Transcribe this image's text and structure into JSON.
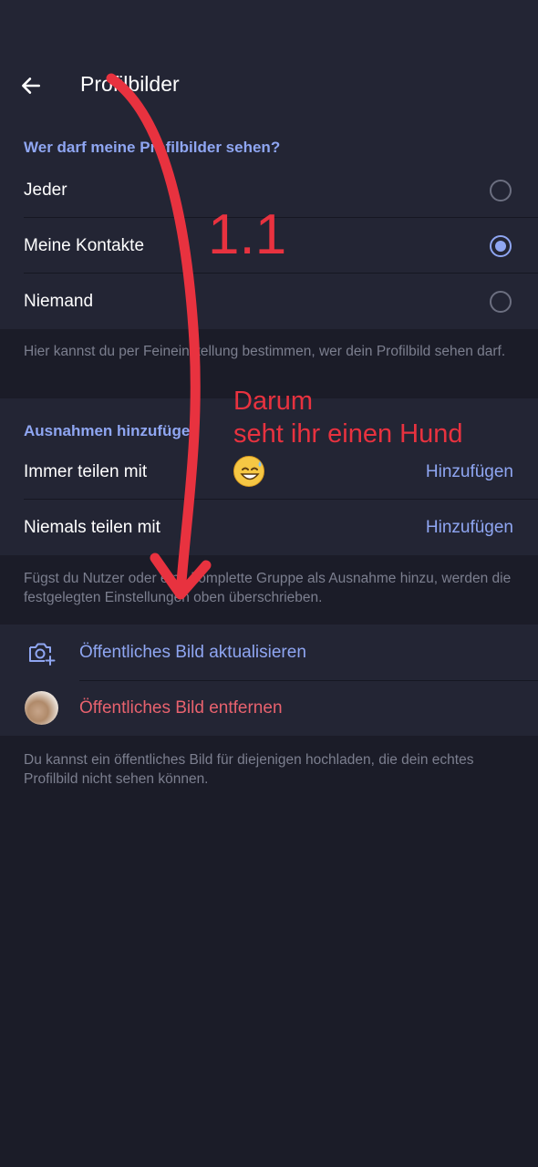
{
  "header": {
    "title": "Profilbilder",
    "back_icon": "arrow-left-icon"
  },
  "visibility": {
    "section_title": "Wer darf meine Profilbilder sehen?",
    "options": [
      {
        "label": "Jeder",
        "selected": false
      },
      {
        "label": "Meine Kontakte",
        "selected": true
      },
      {
        "label": "Niemand",
        "selected": false
      }
    ],
    "hint": "Hier kannst du per Feineinstellung bestimmen, wer dein Profilbild sehen darf."
  },
  "exceptions": {
    "section_title": "Ausnahmen hinzufügen",
    "rows": [
      {
        "label": "Immer teilen mit",
        "action": "Hinzufügen"
      },
      {
        "label": "Niemals teilen mit",
        "action": "Hinzufügen"
      }
    ],
    "hint": "Fügst du Nutzer oder eine komplette Gruppe als Ausnahme hinzu, werden die festgelegten Einstellungen oben überschrieben."
  },
  "public_photo": {
    "update_label": "Öffentliches Bild aktualisieren",
    "update_icon": "camera-add-icon",
    "remove_label": "Öffentliches Bild entfernen",
    "remove_icon": "avatar-thumbnail",
    "hint": "Du kannst ein öffentliches Bild für diejenigen hochladen, die dein echtes Profilbild nicht sehen können."
  },
  "annotation": {
    "number": "1.1",
    "line1": "Darum",
    "line2": "seht ihr einen Hund",
    "emoji": "sweat-smile-emoji"
  },
  "colors": {
    "accent": "#8fa6f2",
    "danger": "#e8626e",
    "annotation": "#e8323f",
    "background": "#1b1c28",
    "surface": "#232534"
  }
}
